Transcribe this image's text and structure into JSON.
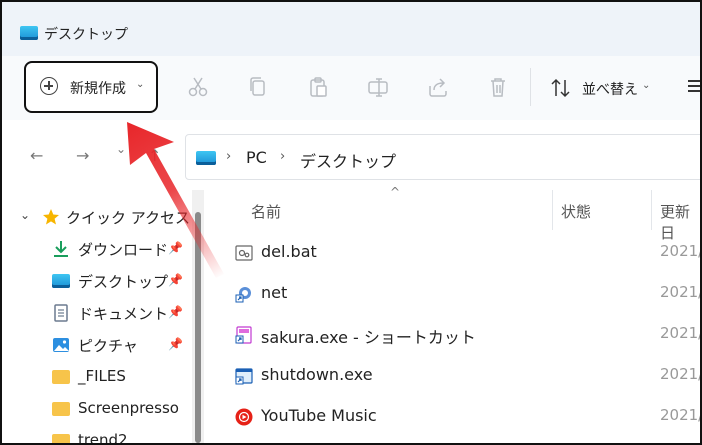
{
  "window": {
    "title": "デスクトップ"
  },
  "toolbar": {
    "new_label": "新規作成",
    "new_chevron": "⌄",
    "sort_label": "並べ替え",
    "sort_chevron": "⌄"
  },
  "nav": {
    "back": "←",
    "forward": "→",
    "recent": "⌄",
    "up": "↑"
  },
  "breadcrumb": {
    "separator": "›",
    "items": [
      "PC",
      "デスクトップ"
    ]
  },
  "sidebar": {
    "items": [
      {
        "label": "クイック アクセス",
        "icon": "star-icon"
      },
      {
        "label": "ダウンロード",
        "icon": "download-icon",
        "pinned": true
      },
      {
        "label": "デスクトップ",
        "icon": "desktop-icon",
        "pinned": true
      },
      {
        "label": "ドキュメント",
        "icon": "document-icon",
        "pinned": true
      },
      {
        "label": "ピクチャ",
        "icon": "picture-icon",
        "pinned": true
      },
      {
        "label": "_FILES",
        "icon": "folder-icon"
      },
      {
        "label": "Screenpresso",
        "icon": "folder-icon"
      },
      {
        "label": "trend2",
        "icon": "folder-icon"
      }
    ],
    "pin_glyph": "📌",
    "expand_glyph": "⌄"
  },
  "columns": {
    "name": "名前",
    "status": "状態",
    "modified": "更新日",
    "sort_caret": "^"
  },
  "files": [
    {
      "name": "del.bat",
      "date": "2021/",
      "icon": "batch-file-icon"
    },
    {
      "name": "net",
      "date": "2021/",
      "icon": "shortcut-icon"
    },
    {
      "name": "sakura.exe - ショートカット",
      "date": "2021/",
      "icon": "shortcut-icon"
    },
    {
      "name": "shutdown.exe",
      "date": "2021/",
      "icon": "shortcut-icon"
    },
    {
      "name": "YouTube Music",
      "date": "2021/",
      "icon": "youtube-music-icon"
    }
  ],
  "colors": {
    "annotation_arrow": "#e8262a",
    "folder": "#f7c44a"
  }
}
